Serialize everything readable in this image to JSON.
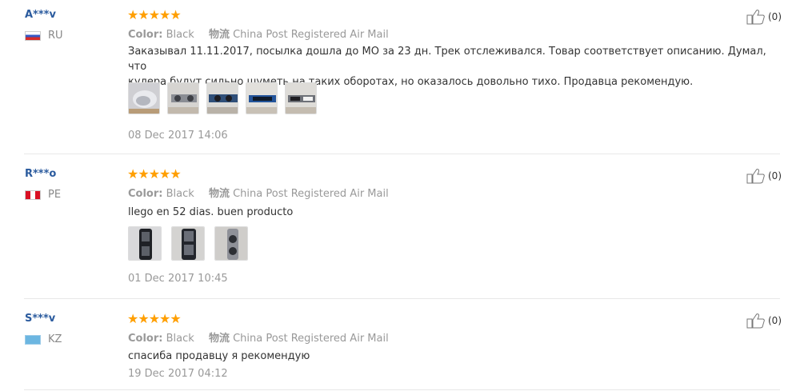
{
  "labels": {
    "color_key": "Color:",
    "shipping_key": "物流"
  },
  "reviews": [
    {
      "user": "A***v",
      "country": "RU",
      "stars": "★★★★★",
      "color": "Black",
      "shipping": "China Post Registered Air Mail",
      "text_line1": "Заказывал 11.11.2017, посылка дошла до МО за 23 дн. Трек отслеживался. Товар соответствует описанию. Думал, что",
      "text_line2": "кулера будут сильно шуметь на таких оборотах, но оказалось довольно тихо. Продавца рекомендую.",
      "date": "08 Dec 2017 14:06",
      "helpful": "(0)"
    },
    {
      "user": "R***o",
      "country": "PE",
      "stars": "★★★★★",
      "color": "Black",
      "shipping": "China Post Registered Air Mail",
      "text_line1": "llego en 52 dias. buen producto",
      "date": "01 Dec 2017 10:45",
      "helpful": "(0)"
    },
    {
      "user": "S***v",
      "country": "KZ",
      "stars": "★★★★★",
      "color": "Black",
      "shipping": "China Post Registered Air Mail",
      "text_line1": "спасиба продавцу я рекомендую",
      "date": "19 Dec 2017 04:12",
      "helpful": "(0)"
    }
  ]
}
